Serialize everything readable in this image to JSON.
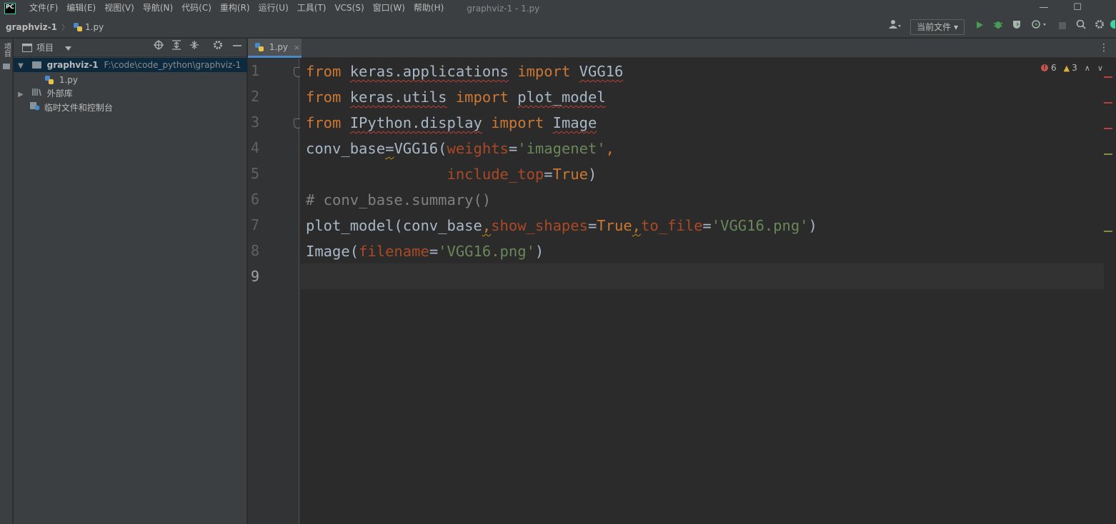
{
  "app": {
    "logo_text": "PC",
    "window_title": "graphviz-1 - 1.py"
  },
  "menu": [
    "文件(F)",
    "编辑(E)",
    "视图(V)",
    "导航(N)",
    "代码(C)",
    "重构(R)",
    "运行(U)",
    "工具(T)",
    "VCS(S)",
    "窗口(W)",
    "帮助(H)"
  ],
  "window_controls": {
    "minimize": "—",
    "maximize": "☐"
  },
  "breadcrumb": {
    "project": "graphviz-1",
    "separator": "〉",
    "file": "1.py"
  },
  "toolbar": {
    "run_config": "当前文件 ▾"
  },
  "left_stripe": {
    "project_label": "项目"
  },
  "project_panel": {
    "title": "项目",
    "root": {
      "name": "graphviz-1",
      "path": "F:\\code\\code_python\\graphviz-1"
    },
    "items": [
      {
        "label": "1.py"
      },
      {
        "label": "外部库"
      },
      {
        "label": "临时文件和控制台"
      }
    ]
  },
  "editor": {
    "tab_label": "1.py",
    "tab_close": "×",
    "line_numbers": [
      "1",
      "2",
      "3",
      "4",
      "5",
      "6",
      "7",
      "8",
      "9"
    ],
    "inspections": {
      "errors": "6",
      "warnings": "3"
    },
    "code": {
      "l1": [
        "from",
        " ",
        "keras.applications",
        " ",
        "import",
        " ",
        "VGG16"
      ],
      "l2": [
        "from",
        " ",
        "keras.utils",
        " ",
        "import",
        " ",
        "plot_model"
      ],
      "l3": [
        "from",
        " ",
        "IPython.display",
        " ",
        "import",
        " ",
        "Image"
      ],
      "l4": [
        "conv_base",
        "=",
        "VGG16(",
        "weights",
        "=",
        "'imagenet'",
        ","
      ],
      "l5": [
        "                ",
        "include_top",
        "=",
        "True",
        ")"
      ],
      "l6": [
        "# conv_base.summary()"
      ],
      "l7": [
        "plot_model(conv_base",
        ",",
        "show_shapes",
        "=",
        "True",
        ",",
        "to_file",
        "=",
        "'VGG16.png'",
        ")"
      ],
      "l8": [
        "Image(",
        "filename",
        "=",
        "'VGG16.png'",
        ")"
      ]
    }
  },
  "colors": {
    "keyword": "#cc7832",
    "string": "#6a8759",
    "comment": "#808080",
    "param": "#aa4926",
    "text": "#a9b7c6",
    "selection": "#0d293e",
    "accent": "#4a88c7"
  },
  "icons": [
    "app-logo-icon",
    "user-icon",
    "run-icon",
    "debug-icon",
    "coverage-icon",
    "profile-icon",
    "stop-icon",
    "search-icon",
    "settings-icon",
    "locate-icon",
    "expand-all-icon",
    "collapse-all-icon",
    "gear-icon",
    "hide-icon",
    "folder-icon",
    "python-file-icon",
    "library-icon",
    "scratches-icon"
  ]
}
